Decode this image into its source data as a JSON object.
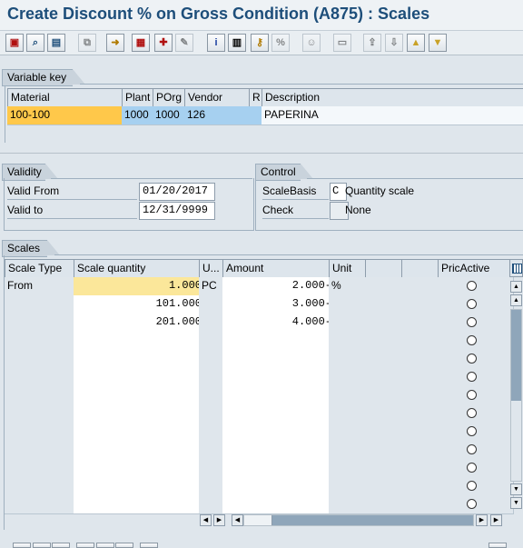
{
  "title": "Create Discount % on Gross Condition (A875) : Scales",
  "toolbar": {
    "buttons": [
      "save-icon",
      "find-icon",
      "display-icon",
      "copy-icon",
      "next-icon",
      "calendar-icon",
      "gift-icon",
      "edit-icon",
      "info-icon",
      "overview-icon",
      "key-icon",
      "percent-icon",
      "person-icon",
      "layout-icon",
      "export-icon",
      "import-icon",
      "scroll-up-icon",
      "scroll-down-icon"
    ]
  },
  "variable_key": {
    "title": "Variable key",
    "headers": [
      "Material",
      "Plant",
      "POrg",
      "Vendor",
      "R",
      "Description"
    ],
    "row": {
      "material": "100-100",
      "plant": "1000",
      "porg": "1000",
      "vendor": "126",
      "r": "",
      "description": "PAPERINA"
    }
  },
  "validity": {
    "title": "Validity",
    "valid_from_label": "Valid From",
    "valid_from": "01/20/2017",
    "valid_to_label": "Valid to",
    "valid_to": "12/31/9999"
  },
  "control": {
    "title": "Control",
    "scale_basis_label": "ScaleBasis",
    "scale_basis_code": "C",
    "scale_basis_text": "Quantity scale",
    "check_label": "Check",
    "check_code": "",
    "check_text": "None"
  },
  "scales": {
    "title": "Scales",
    "headers": [
      "Scale Type",
      "Scale quantity",
      "U...",
      "Amount",
      "Unit",
      "",
      "",
      "PricActive"
    ],
    "rows": [
      {
        "type": "From",
        "qty": "1.000",
        "unit": "PC",
        "amount": "2.000-",
        "curr": "%"
      },
      {
        "type": "",
        "qty": "101.000",
        "unit": "",
        "amount": "3.000-",
        "curr": ""
      },
      {
        "type": "",
        "qty": "201.000",
        "unit": "",
        "amount": "4.000-",
        "curr": ""
      },
      {
        "type": "",
        "qty": "",
        "unit": "",
        "amount": "",
        "curr": ""
      },
      {
        "type": "",
        "qty": "",
        "unit": "",
        "amount": "",
        "curr": ""
      },
      {
        "type": "",
        "qty": "",
        "unit": "",
        "amount": "",
        "curr": ""
      },
      {
        "type": "",
        "qty": "",
        "unit": "",
        "amount": "",
        "curr": ""
      },
      {
        "type": "",
        "qty": "",
        "unit": "",
        "amount": "",
        "curr": ""
      },
      {
        "type": "",
        "qty": "",
        "unit": "",
        "amount": "",
        "curr": ""
      },
      {
        "type": "",
        "qty": "",
        "unit": "",
        "amount": "",
        "curr": ""
      },
      {
        "type": "",
        "qty": "",
        "unit": "",
        "amount": "",
        "curr": ""
      },
      {
        "type": "",
        "qty": "",
        "unit": "",
        "amount": "",
        "curr": ""
      },
      {
        "type": "",
        "qty": "",
        "unit": "",
        "amount": "",
        "curr": ""
      }
    ]
  }
}
